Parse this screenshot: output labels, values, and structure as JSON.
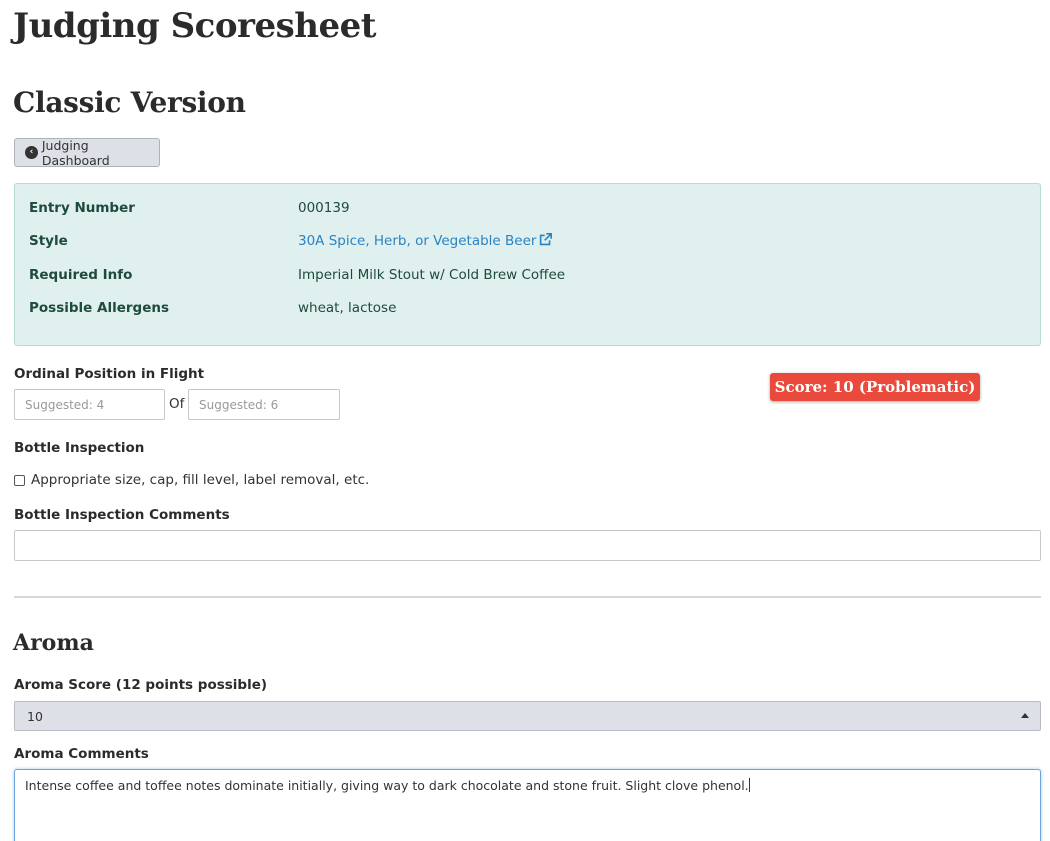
{
  "page": {
    "title": "Judging Scoresheet",
    "subtitle": "Classic Version"
  },
  "toolbar": {
    "dashboard_label": "Judging Dashboard",
    "dashboard_icon": "chevron-left-circle-icon"
  },
  "entry_info": {
    "rows": [
      {
        "label": "Entry Number",
        "value": "000139"
      },
      {
        "label": "Style",
        "value": "30A Spice, Herb, or Vegetable Beer",
        "link": true,
        "icon": "external-link-icon"
      },
      {
        "label": "Required Info",
        "value": "Imperial Milk Stout w/ Cold Brew Coffee"
      },
      {
        "label": "Possible Allergens",
        "value": "wheat, lactose"
      }
    ]
  },
  "ordinal": {
    "label": "Ordinal Position in Flight",
    "position_placeholder": "Suggested: 4",
    "of_text": "Of",
    "total_placeholder": "Suggested: 6"
  },
  "score_badge": {
    "text": "Score: 10 (Problematic)",
    "color": "#ea4a3c"
  },
  "bottle": {
    "heading": "Bottle Inspection",
    "checkbox_label": "Appropriate size, cap, fill level, label removal, etc.",
    "checked": false,
    "comments_label": "Bottle Inspection Comments",
    "comments_value": ""
  },
  "aroma": {
    "heading": "Aroma",
    "score_label": "Aroma Score (12 points possible)",
    "score_value": "10",
    "comments_label": "Aroma Comments",
    "comments_value": "Intense coffee and toffee notes dominate initially, giving way to dark chocolate and stone fruit. Slight clove phenol."
  }
}
